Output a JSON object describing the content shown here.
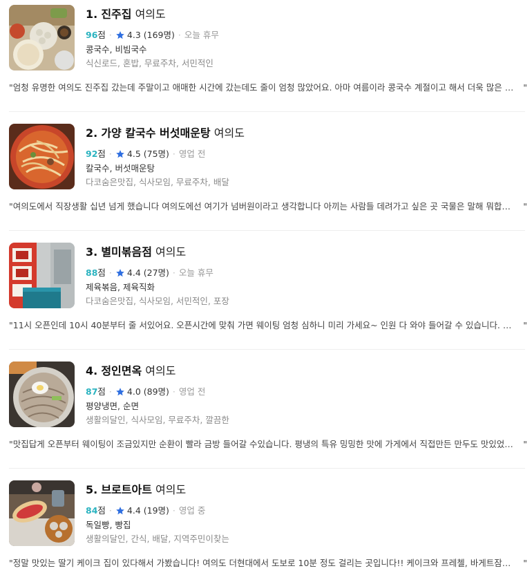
{
  "colors": {
    "score": "#2bb3c0",
    "star": "#2f6fe0",
    "status": "#999999"
  },
  "items": [
    {
      "rank": "1.",
      "name_strong": "진주집",
      "name_light": "여의도",
      "score": "96",
      "score_unit": "점",
      "rating": "4.3 (169명)",
      "status": "오늘 휴무",
      "menu": "콩국수, 비빔국수",
      "tags": "식신로드, 혼밥, 무료주차, 서민적인",
      "review": "\"엄청 유명한 여의도 진주집 갔는데 주말이고 애매한 시간에 갔는데도 줄이 엄청 많았어요. 아마 여름이라 콩국수 계절이고 해서 더욱 많은 …",
      "review_end": "\""
    },
    {
      "rank": "2.",
      "name_strong": "가양 칼국수 버섯매운탕",
      "name_light": "여의도",
      "score": "92",
      "score_unit": "점",
      "rating": "4.5 (75명)",
      "status": "영업 전",
      "menu": "칼국수, 버섯매운탕",
      "tags": "다코숨은맛집, 식사모임, 무료주차, 배달",
      "review": "\"여의도에서 직장생활 십년 넘게 했습니다 여의도에선 여기가 넘버원이라고 생각합니다 아끼는 사람들 데려가고 싶은 곳 국물은 말해 뭐합…",
      "review_end": "\""
    },
    {
      "rank": "3.",
      "name_strong": "별미볶음점",
      "name_light": "여의도",
      "score": "88",
      "score_unit": "점",
      "rating": "4.4 (27명)",
      "status": "오늘 휴무",
      "menu": "제육볶음, 제육직화",
      "tags": "다코숨은맛집, 식사모임, 서민적인, 포장",
      "review": "\"11시 오픈인데 10시 40분부터 줄 서있어요. 오픈시간에 맞춰 가면 웨이팅 엄청 심하니 미리 가세요~ 인원 다 와야 들어갈 수 있습니다. 제…",
      "review_end": "\""
    },
    {
      "rank": "4.",
      "name_strong": "정인면옥",
      "name_light": "여의도",
      "score": "87",
      "score_unit": "점",
      "rating": "4.0 (89명)",
      "status": "영업 전",
      "menu": "평양냉면, 순면",
      "tags": "생활의달인, 식사모임, 무료주차, 깔끔한",
      "review": "\"맛집답게 오픈부터 웨이팅이 조금있지만 순환이 빨라 금방 들어갈 수있습니다. 평냉의 특유 밍밍한 맛에 가게에서 직접만든 만두도 맛있었…",
      "review_end": "\""
    },
    {
      "rank": "5.",
      "name_strong": "브로트아트",
      "name_light": "여의도",
      "score": "84",
      "score_unit": "점",
      "rating": "4.4 (19명)",
      "status": "영업 중",
      "menu": "독일빵, 빵집",
      "tags": "생활의달인, 간식, 배달, 지역주민이찾는",
      "review": "\"정말 맛있는 딸기 케이크 집이 있다해서 가봤습니다! 여의도 더현대에서 도보로 10분 정도 걸리는 곳입니다!! 케이크와 프레첼, 바게트잠…",
      "review_end": "\""
    }
  ]
}
